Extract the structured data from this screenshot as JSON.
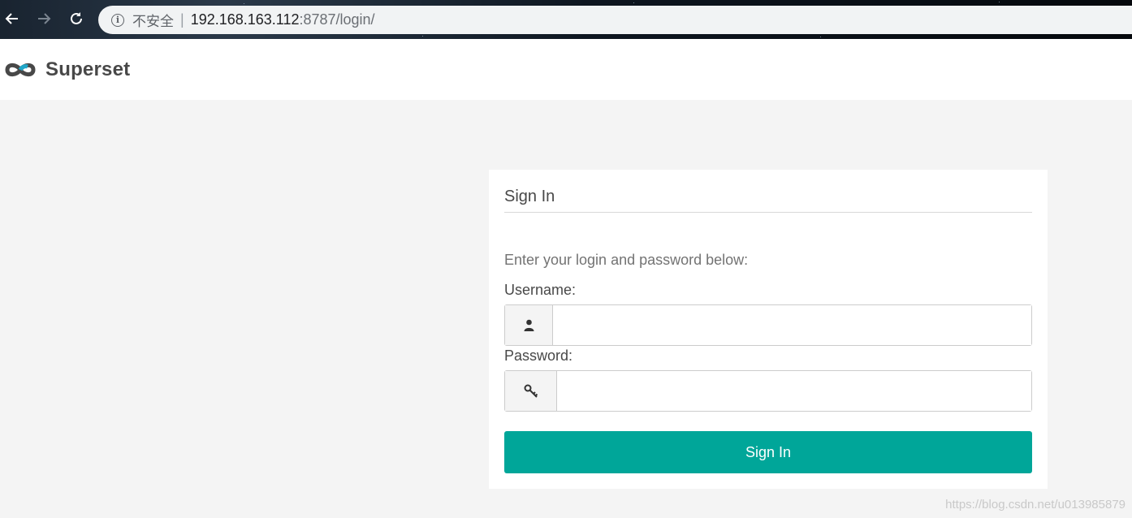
{
  "browser": {
    "back_icon": "arrow-left-icon",
    "forward_icon": "arrow-right-icon",
    "reload_icon": "reload-icon",
    "security_label": "不安全",
    "separator": "|",
    "url_host": "192.168.163.112",
    "url_path": ":8787/login/"
  },
  "navbar": {
    "brand": "Superset",
    "logo_colors": {
      "dark": "#484848",
      "accent": "#20a7c9"
    }
  },
  "login": {
    "title": "Sign In",
    "hint": "Enter your login and password below:",
    "username_label": "Username:",
    "username_value": "",
    "password_label": "Password:",
    "password_value": "",
    "submit_label": "Sign In",
    "user_icon": "user-icon",
    "key_icon": "key-icon"
  },
  "colors": {
    "primary": "#00a699",
    "page_background": "#f4f4f4"
  },
  "watermark": "https://blog.csdn.net/u013985879"
}
